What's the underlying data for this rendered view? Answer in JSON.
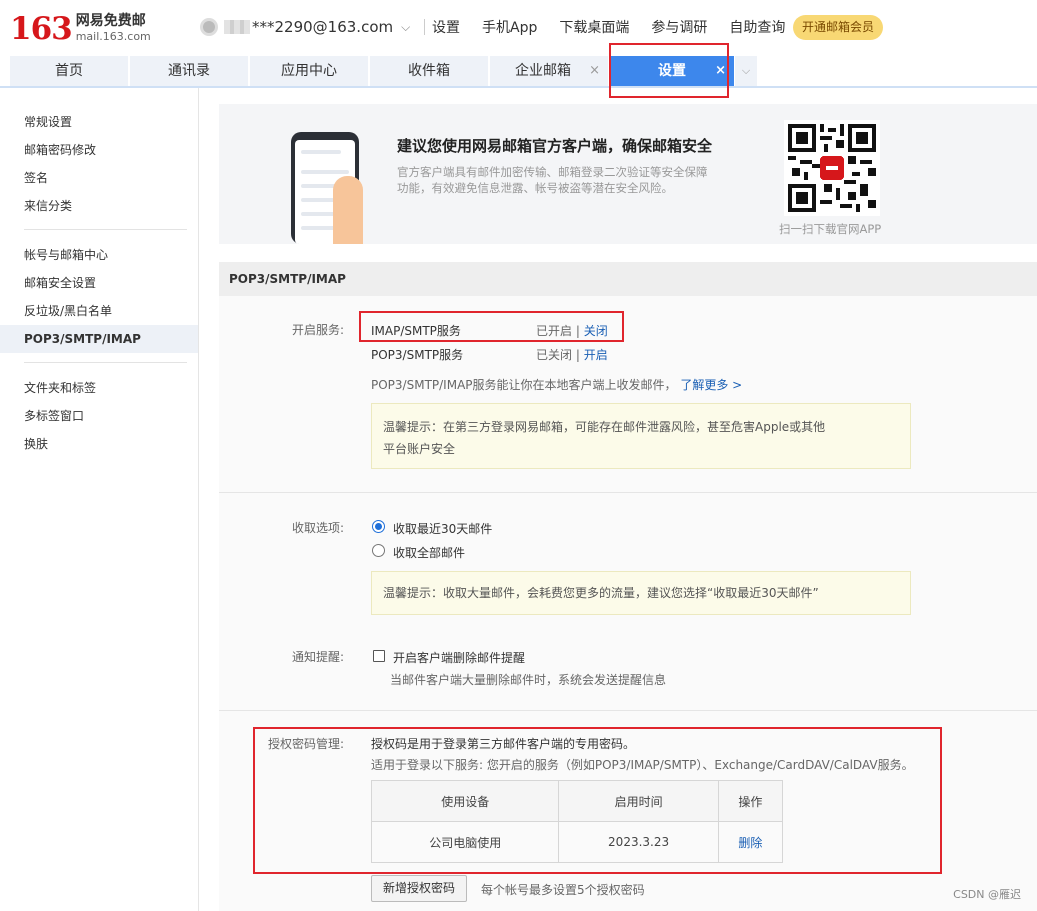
{
  "logo": {
    "number": "163",
    "cn": "网易免费邮",
    "domain": "mail.163.com"
  },
  "account": {
    "name": "***2290@163.com"
  },
  "top_nav": [
    "设置",
    "手机App",
    "下载桌面端",
    "参与调研",
    "自助查询"
  ],
  "vip_button": "开通邮箱会员",
  "tabs": {
    "home": "首页",
    "contacts": "通讯录",
    "apps": "应用中心",
    "inbox": "收件箱",
    "enterprise": "企业邮箱",
    "settings": "设置",
    "close": "×"
  },
  "sidebar": {
    "group1": [
      "常规设置",
      "邮箱密码修改",
      "签名",
      "来信分类"
    ],
    "group2": [
      "帐号与邮箱中心",
      "邮箱安全设置",
      "反垃圾/黑白名单",
      "POP3/SMTP/IMAP"
    ],
    "group3": [
      "文件夹和标签",
      "多标签窗口",
      "换肤"
    ]
  },
  "banner": {
    "title": "建议您使用网易邮箱官方客户端，确保邮箱安全",
    "desc": "官方客户端具有邮件加密传输、邮箱登录二次验证等安全保障功能，有效避免信息泄露、帐号被盗等潜在安全风险。",
    "qr_caption": "扫一扫下载官网APP"
  },
  "section_title": "POP3/SMTP/IMAP",
  "service": {
    "label": "开启服务:",
    "imap": {
      "name": "IMAP/SMTP服务",
      "status": "已开启",
      "sep": "|",
      "action": "关闭"
    },
    "pop3": {
      "name": "POP3/SMTP服务",
      "status": "已关闭",
      "sep": "|",
      "action": "开启"
    },
    "info": "POP3/SMTP/IMAP服务能让你在本地客户端上收发邮件，",
    "learn_more": "了解更多 >",
    "tip_line1": "温馨提示：在第三方登录网易邮箱，可能存在邮件泄露风险，甚至危害Apple或其他",
    "tip_line2": "平台账户安全"
  },
  "fetch": {
    "label": "收取选项:",
    "opt1": "收取最近30天邮件",
    "opt2": "收取全部邮件",
    "tip": "温馨提示：收取大量邮件，会耗费您更多的流量，建议您选择“收取最近30天邮件”"
  },
  "notify": {
    "label": "通知提醒:",
    "checkbox": "开启客户端删除邮件提醒",
    "desc": "当邮件客户端大量删除邮件时，系统会发送提醒信息"
  },
  "auth": {
    "label": "授权密码管理:",
    "desc1": "授权码是用于登录第三方邮件客户端的专用密码。",
    "desc2": "适用于登录以下服务: 您开启的服务（例如POP3/IMAP/SMTP）、Exchange/CardDAV/CalDAV服务。",
    "headers": [
      "使用设备",
      "启用时间",
      "操作"
    ],
    "rows": [
      {
        "device": "公司电脑使用",
        "date": "2023.3.23",
        "action": "删除"
      }
    ],
    "add_button": "新增授权密码",
    "limit": "每个帐号最多设置5个授权密码"
  },
  "watermark": "CSDN @雁迟"
}
